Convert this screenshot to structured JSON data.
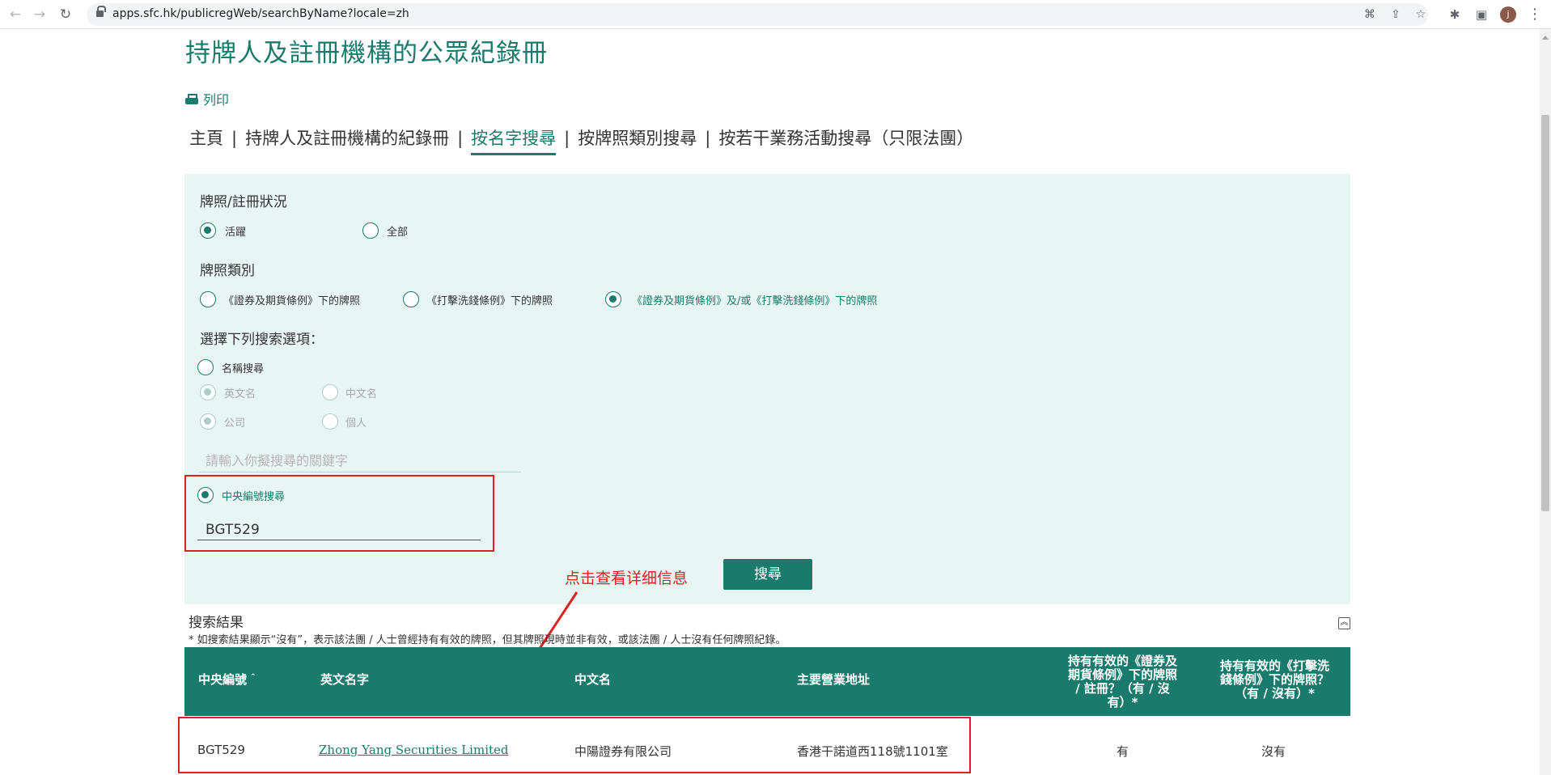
{
  "browser": {
    "url": "apps.sfc.hk/publicregWeb/searchByName?locale=zh",
    "avatar_letter": "j"
  },
  "page": {
    "title": "持牌人及註冊機構的公眾紀錄冊",
    "print_label": "列印"
  },
  "tabs": [
    {
      "label": "主頁",
      "active": false
    },
    {
      "label": "持牌人及註冊機構的紀錄冊",
      "active": false
    },
    {
      "label": "按名字搜尋",
      "active": true
    },
    {
      "label": "按牌照類別搜尋",
      "active": false
    },
    {
      "label": "按若干業務活動搜尋（只限法團）",
      "active": false
    }
  ],
  "tab_separator": "|",
  "form": {
    "status": {
      "label": "牌照/註冊狀況",
      "options": [
        {
          "label": "活躍",
          "selected": true
        },
        {
          "label": "全部",
          "selected": false
        }
      ]
    },
    "licence_type": {
      "label": "牌照類別",
      "options": [
        {
          "label": "《證券及期貨條例》下的牌照",
          "selected": false
        },
        {
          "label": "《打擊洗錢條例》下的牌照",
          "selected": false
        },
        {
          "label": "《證券及期貨條例》及/或《打擊洗錢條例》下的牌照",
          "selected": true
        }
      ]
    },
    "search_options_label": "選擇下列搜索選項：",
    "name_search": {
      "label": "名稱搜尋",
      "selected": false,
      "lang_options": [
        {
          "label": "英文名",
          "selected": true
        },
        {
          "label": "中文名",
          "selected": false
        }
      ],
      "entity_options": [
        {
          "label": "公司",
          "selected": true
        },
        {
          "label": "個人",
          "selected": false
        }
      ],
      "keyword_placeholder": "請輸入你擬搜尋的關鍵字"
    },
    "ce_search": {
      "label": "中央編號搜尋",
      "selected": true,
      "value": "BGT529"
    },
    "search_button": "搜尋"
  },
  "annotation": {
    "text": "点击查看详细信息",
    "color": "#e02020"
  },
  "results": {
    "title": "搜索結果",
    "note": "* 如搜索結果顯示“沒有”，表示該法團 / 人士曾經持有有效的牌照，但其牌照現時並非有效，或該法團 / 人士沒有任何牌照紀錄。",
    "columns": {
      "ce_no": "中央編號",
      "en_name": "英文名字",
      "cn_name": "中文名",
      "address": "主要營業地址",
      "sfo_line1": "持有有效的《證券及",
      "sfo_line2": "期貨條例》下的牌照",
      "sfo_line3": "/ 註冊？（有 / 沒",
      "sfo_line4": "有）*",
      "amlo_line1": "持有有效的《打擊洗",
      "amlo_line2": "錢條例》下的牌照？",
      "amlo_line3": "（有 / 沒有）*"
    },
    "rows": [
      {
        "ce_no": "BGT529",
        "en_name": "Zhong Yang Securities Limited",
        "cn_name": "中陽證券有限公司",
        "address": "香港干諾道西118號1101室",
        "sfo": "有",
        "amlo": "沒有"
      }
    ]
  },
  "colors": {
    "brand": "#1a7a6c",
    "panel_bg": "#e8f6f3",
    "highlight": "#e02020"
  }
}
